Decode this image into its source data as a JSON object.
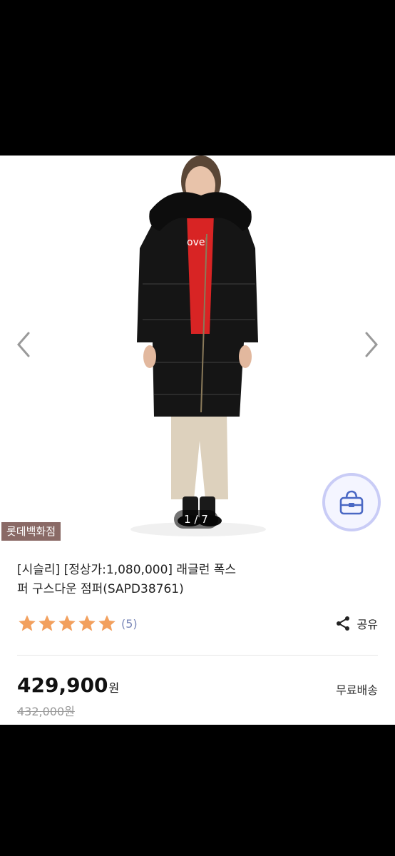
{
  "gallery": {
    "counter": "1 / 7",
    "shirt_text": "ovel"
  },
  "seller": {
    "badge": "롯데백화점"
  },
  "product": {
    "title_line1": "[시슬리] [정상가:1,080,000] 래글런 폭스",
    "title_line2": "퍼 구스다운 점퍼(SAPD38761)",
    "rating": {
      "stars": 5,
      "max": 5,
      "review_count": "(5)"
    },
    "share_label": "공유",
    "price": "429,900",
    "price_unit": "원",
    "original_price": "432,000원",
    "shipping": "무료배송"
  },
  "colors": {
    "star": "#f2a05e",
    "bag_icon": "#4a68c4",
    "seller_badge": "#8a6a66"
  },
  "icons": [
    "chevron-left-icon",
    "chevron-right-icon",
    "shopping-bag-icon",
    "star-icon",
    "share-icon"
  ]
}
